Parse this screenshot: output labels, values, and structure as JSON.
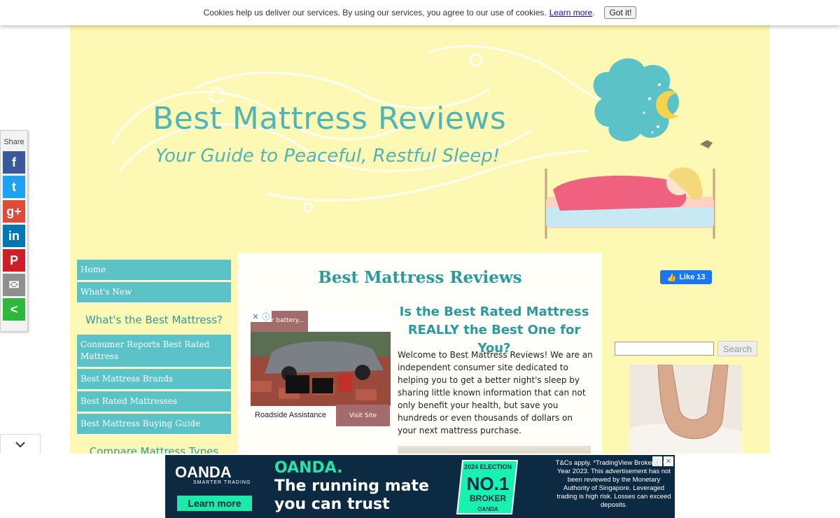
{
  "cookie_bar": {
    "message": "Cookies help us deliver our services. By using our services, you agree to our use of cookies.",
    "learn_more": "Learn more",
    "punct": ".",
    "got_it": "Got it!"
  },
  "header": {
    "title": "Best Mattress Reviews",
    "tagline": "Your Guide to Peaceful, Restful Sleep!"
  },
  "share": {
    "label": "Share",
    "buttons": [
      {
        "name": "facebook",
        "glyph": "f",
        "color": "#3b5998"
      },
      {
        "name": "twitter",
        "glyph": "t",
        "color": "#1da1f2"
      },
      {
        "name": "google-plus",
        "glyph": "g+",
        "color": "#dd4b39"
      },
      {
        "name": "linkedin",
        "glyph": "in",
        "color": "#0077b5"
      },
      {
        "name": "pinterest",
        "glyph": "P",
        "color": "#cb2027"
      },
      {
        "name": "email",
        "glyph": "✉",
        "color": "#8f8f8f"
      },
      {
        "name": "share",
        "glyph": "<",
        "color": "#2db83d"
      }
    ]
  },
  "nav": {
    "items_top": [
      "Home",
      "What's New"
    ],
    "heading1": "What's the Best Mattress?",
    "items_mid": [
      "Consumer Reports Best Rated Mattress",
      "Best Mattress Brands",
      "Best Rated Mattresses",
      "Best Mattress Buying Guide"
    ],
    "heading2": "Compare Mattress Types"
  },
  "content": {
    "title": "Best Mattress Reviews",
    "subhead": "Is the Best Rated Mattress REALLY the Best One for You?",
    "body": "Welcome to Best Mattress Reviews! We are an independent consumer site dedicated to helping you to get a better night's sleep by sharing little known information that can not only benefit your health, but save you hundreds or even thousands of dollars on your next mattress purchase."
  },
  "inline_ad": {
    "top_text": "Car battery...",
    "caption": "Roadside Assistance",
    "visit": "Visit Site"
  },
  "right": {
    "fb_like": "Like 13",
    "search_button": "Search"
  },
  "bottom_ad": {
    "brand": "OANDA",
    "brand_sub": "SMARTER TRADING",
    "learn_more": "Learn more",
    "headline1": "OANDA.",
    "headline2": "The running mate",
    "headline3": "you can trust",
    "badge_top": "2024 ELECTION",
    "badge_no1": "NO.1",
    "badge_broker": "BROKER",
    "fine_print": "T&Cs apply. *TradingView Broker of the Year 2023. This advertisement has not been reviewed by the Monetary Authority of Singapore. Leveraged trading is high risk. Losses can exceed deposits."
  }
}
